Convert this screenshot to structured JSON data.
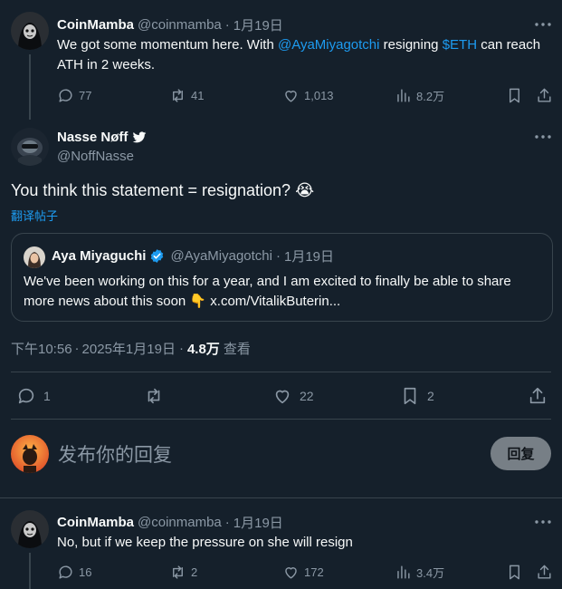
{
  "tweet1": {
    "name": "CoinMamba",
    "handle": "@coinmamba",
    "sep": "·",
    "date": "1月19日",
    "text_part1": "We got some momentum here. With ",
    "mention": "@AyaMiyagotchi",
    "text_part2": " resigning ",
    "cashtag": "$ETH",
    "text_part3": " can reach ATH in 2 weeks.",
    "replies": "77",
    "retweets": "41",
    "likes": "1,013",
    "views": "8.2万"
  },
  "main": {
    "name": "Nasse Nøff",
    "handle": "@NoffNasse",
    "text": "You think this statement = resignation?",
    "emoji": "😭",
    "translate": "翻译帖子",
    "quote": {
      "name": "Aya Miyaguchi",
      "handle": "@AyaMiyagotchi",
      "sep": "·",
      "date": "1月19日",
      "text": "We've been working on this for a year, and I am excited to finally be able to share more news about this soon 👇 x.com/VitalikButerin..."
    },
    "time": "下午10:56",
    "sep": "·",
    "date": "2025年1月19日",
    "sep2": "·",
    "views_count": "4.8万",
    "views_label": "查看",
    "replies": "1",
    "likes": "22",
    "bookmarks": "2"
  },
  "composer": {
    "placeholder": "发布你的回复",
    "button": "回复"
  },
  "tweet2": {
    "name": "CoinMamba",
    "handle": "@coinmamba",
    "sep": "·",
    "date": "1月19日",
    "text": "No, but if we keep the pressure on she will resign",
    "replies": "16",
    "retweets": "2",
    "likes": "172",
    "views": "3.4万"
  },
  "colors": {
    "background": "#15202b",
    "link": "#1d9bf0",
    "muted": "#8b98a5",
    "verified": "#1d9bf0"
  }
}
